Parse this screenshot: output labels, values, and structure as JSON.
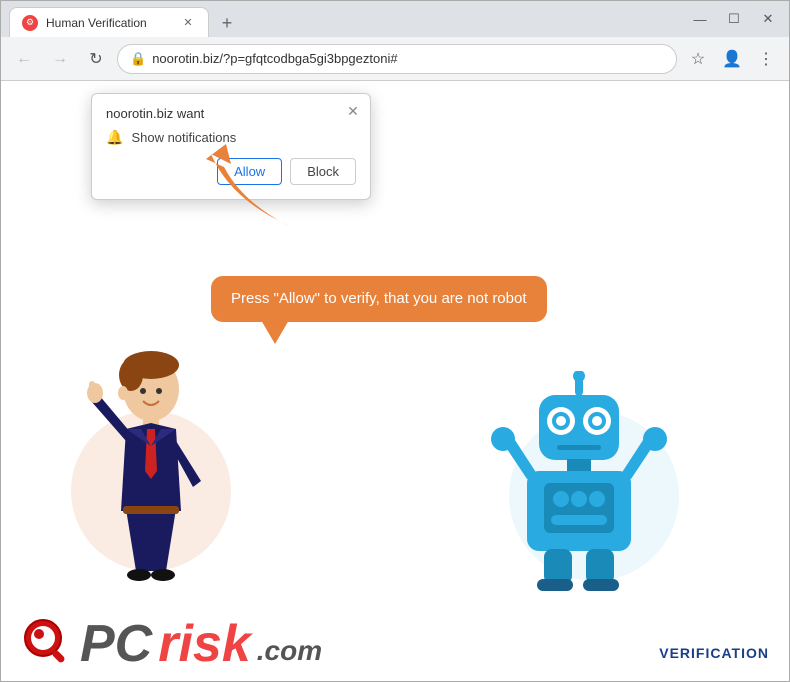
{
  "window": {
    "title": "Human Verification",
    "new_tab_symbol": "+",
    "controls": {
      "minimize": "—",
      "maximize": "☐",
      "close": "✕"
    }
  },
  "toolbar": {
    "back": "←",
    "forward": "→",
    "reload": "↻",
    "address": "noorotin.biz/?p=gfqtcodbga5gi3bpgeztoni#",
    "lock": "🔒",
    "bookmark": "☆",
    "profile": "👤",
    "menu": "⋮"
  },
  "popup": {
    "title": "noorotin.biz want",
    "close": "✕",
    "option_text": "Show notifications",
    "allow_label": "Allow",
    "block_label": "Block"
  },
  "speech_bubble": {
    "text": "Press \"Allow\" to verify, that you are not robot"
  },
  "footer": {
    "pc_text": "PC",
    "risk_text": "risk",
    "dot_com": ".com",
    "verification": "VERIFICATION"
  }
}
